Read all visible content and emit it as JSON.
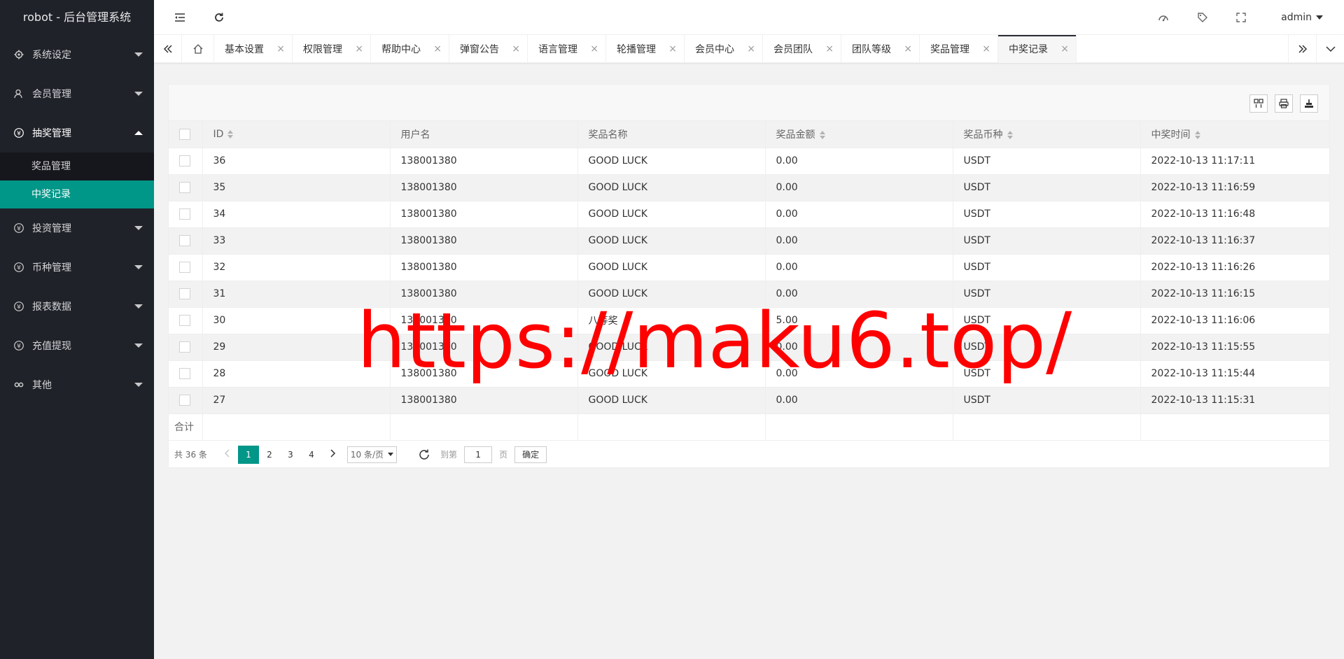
{
  "app": {
    "title": "robot - 后台管理系统"
  },
  "sidebar": {
    "items": [
      {
        "label": "系统设定",
        "icon": "gear-icon"
      },
      {
        "label": "会员管理",
        "icon": "user-icon"
      },
      {
        "label": "抽奖管理",
        "icon": "yen-icon",
        "open": true,
        "children": [
          {
            "label": "奖品管理"
          },
          {
            "label": "中奖记录",
            "active": true
          }
        ]
      },
      {
        "label": "投资管理",
        "icon": "yen-icon"
      },
      {
        "label": "币种管理",
        "icon": "yen-icon"
      },
      {
        "label": "报表数据",
        "icon": "yen-icon"
      },
      {
        "label": "充值提现",
        "icon": "yen-icon"
      },
      {
        "label": "其他",
        "icon": "link-icon"
      }
    ]
  },
  "header": {
    "user": "admin"
  },
  "tabs": [
    {
      "label": "基本设置"
    },
    {
      "label": "权限管理"
    },
    {
      "label": "帮助中心"
    },
    {
      "label": "弹窗公告"
    },
    {
      "label": "语言管理"
    },
    {
      "label": "轮播管理"
    },
    {
      "label": "会员中心"
    },
    {
      "label": "会员团队"
    },
    {
      "label": "团队等级"
    },
    {
      "label": "奖品管理"
    },
    {
      "label": "中奖记录",
      "active": true
    }
  ],
  "table": {
    "columns": [
      "ID",
      "用户名",
      "奖品名称",
      "奖品金额",
      "奖品币种",
      "中奖时间"
    ],
    "rows": [
      [
        "36",
        "138001380",
        "GOOD LUCK",
        "0.00",
        "USDT",
        "2022-10-13 11:17:11"
      ],
      [
        "35",
        "138001380",
        "GOOD LUCK",
        "0.00",
        "USDT",
        "2022-10-13 11:16:59"
      ],
      [
        "34",
        "138001380",
        "GOOD LUCK",
        "0.00",
        "USDT",
        "2022-10-13 11:16:48"
      ],
      [
        "33",
        "138001380",
        "GOOD LUCK",
        "0.00",
        "USDT",
        "2022-10-13 11:16:37"
      ],
      [
        "32",
        "138001380",
        "GOOD LUCK",
        "0.00",
        "USDT",
        "2022-10-13 11:16:26"
      ],
      [
        "31",
        "138001380",
        "GOOD LUCK",
        "0.00",
        "USDT",
        "2022-10-13 11:16:15"
      ],
      [
        "30",
        "138001380",
        "八等奖",
        "5.00",
        "USDT",
        "2022-10-13 11:16:06"
      ],
      [
        "29",
        "138001380",
        "GOOD LUCK",
        "0.00",
        "USDT",
        "2022-10-13 11:15:55"
      ],
      [
        "28",
        "138001380",
        "GOOD LUCK",
        "0.00",
        "USDT",
        "2022-10-13 11:15:44"
      ],
      [
        "27",
        "138001380",
        "GOOD LUCK",
        "0.00",
        "USDT",
        "2022-10-13 11:15:31"
      ]
    ],
    "total_label": "合计"
  },
  "pager": {
    "count": "共 36 条",
    "pages": [
      "1",
      "2",
      "3",
      "4"
    ],
    "current": "1",
    "limit": "10 条/页",
    "goto_label": "到第",
    "goto_value": "1",
    "page_unit": "页",
    "confirm": "确定"
  },
  "watermark": "https://maku6.top/",
  "colors": {
    "accent": "#009688",
    "sidebar_bg": "#20222a",
    "watermark": "#ff0000"
  }
}
